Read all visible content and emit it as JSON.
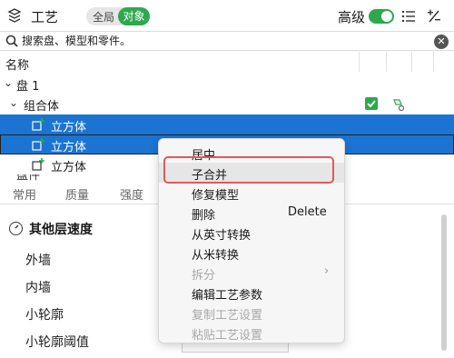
{
  "header": {
    "title": "工艺",
    "scope_all": "全局",
    "scope_object": "对象",
    "advanced_label": "高级"
  },
  "search": {
    "placeholder": "搜索盘、模型和零件。"
  },
  "tree": {
    "column_name": "名称",
    "plate": "盘 1",
    "group": "组合体",
    "items": [
      "立方体",
      "立方体",
      "立方体"
    ],
    "partial": "盘件"
  },
  "tabs": [
    "常用",
    "质量",
    "强度"
  ],
  "section": {
    "title": "其他层速度",
    "props": [
      "外墙",
      "内墙",
      "小轮廓",
      "小轮廓阈值"
    ]
  },
  "menu": {
    "items": [
      {
        "label": "居中",
        "disabled": false
      },
      {
        "label": "子合并",
        "disabled": false
      },
      {
        "label": "修复模型",
        "disabled": false
      },
      {
        "label": "删除",
        "shortcut": "Delete",
        "disabled": false
      },
      {
        "label": "从英寸转换",
        "disabled": false
      },
      {
        "label": "从米转换",
        "disabled": false
      },
      {
        "label": "拆分",
        "disabled": true,
        "submenu": true
      },
      {
        "label": "编辑工艺参数",
        "disabled": false
      },
      {
        "label": "复制工艺设置",
        "disabled": true
      },
      {
        "label": "粘贴工艺设置",
        "disabled": true
      }
    ]
  },
  "colors": {
    "accent": "#2ea84e",
    "selection": "#1b74d1",
    "highlight_box": "#e05a5a"
  }
}
